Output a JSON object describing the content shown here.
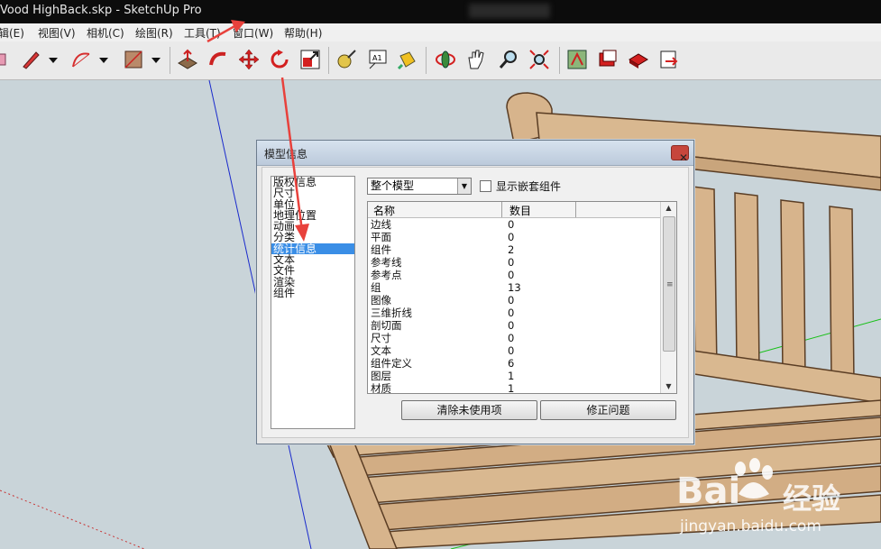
{
  "window": {
    "title": "Wood HighBack.skp - SketchUp Pro",
    "title_visible": "Vood HighBack.skp - SketchUp Pro"
  },
  "menu": {
    "items": [
      "编辑(E)",
      "视图(V)",
      "相机(C)",
      "绘图(R)",
      "工具(T)",
      "窗口(W)",
      "帮助(H)"
    ],
    "items_visible": [
      "编辑(E)",
      "视图(V)",
      "相机(C)",
      "绘图(R)",
      "工具(T)",
      "窗口(W)",
      "帮助(H)"
    ]
  },
  "toolbar": {
    "icons": [
      "eraser-icon",
      "pencil-icon",
      "arc-icon",
      "rectangle-icon",
      "push-pull-icon",
      "follow-me-icon",
      "move-icon",
      "rotate-icon",
      "scale-icon",
      "tape-measure-icon",
      "text-icon",
      "paint-bucket-icon",
      "orbit-icon",
      "pan-icon",
      "zoom-icon",
      "zoom-extents-icon",
      "get-models-icon",
      "share-model-icon",
      "components-icon",
      "send-to-layout-icon"
    ]
  },
  "dialog": {
    "title": "模型信息",
    "close_symbol": "✕",
    "categories": [
      "版权信息",
      "尺寸",
      "单位",
      "地理位置",
      "动画",
      "分类",
      "统计信息",
      "文本",
      "文件",
      "渲染",
      "组件"
    ],
    "selected_index": 6,
    "scope_select": {
      "value": "整个模型",
      "arrow": "▼"
    },
    "show_nested_label": "显示嵌套组件",
    "show_nested_checked": false,
    "table": {
      "headers": [
        "名称",
        "数目"
      ],
      "rows": [
        {
          "name": "边线",
          "count": "0"
        },
        {
          "name": "平面",
          "count": "0"
        },
        {
          "name": "组件",
          "count": "2"
        },
        {
          "name": "参考线",
          "count": "0"
        },
        {
          "name": "参考点",
          "count": "0"
        },
        {
          "name": "组",
          "count": "13"
        },
        {
          "name": "图像",
          "count": "0"
        },
        {
          "name": "三维折线",
          "count": "0"
        },
        {
          "name": "剖切面",
          "count": "0"
        },
        {
          "name": "尺寸",
          "count": "0"
        },
        {
          "name": "文本",
          "count": "0"
        },
        {
          "name": "组件定义",
          "count": "6"
        },
        {
          "name": "图层",
          "count": "1"
        },
        {
          "name": "材质",
          "count": "1"
        }
      ],
      "scroll_grip": "≡"
    },
    "purge_button": "清除未使用项",
    "fix_button": "修正问题"
  },
  "watermark": {
    "brand": "Bai",
    "brand_suffix": "经验",
    "url": "jingyan.baidu.com"
  },
  "colors": {
    "selection": "#3a8ee6",
    "annotation_arrow": "#e8413c",
    "wood": "#d7b48c",
    "wood_edge": "#5a3d24"
  }
}
